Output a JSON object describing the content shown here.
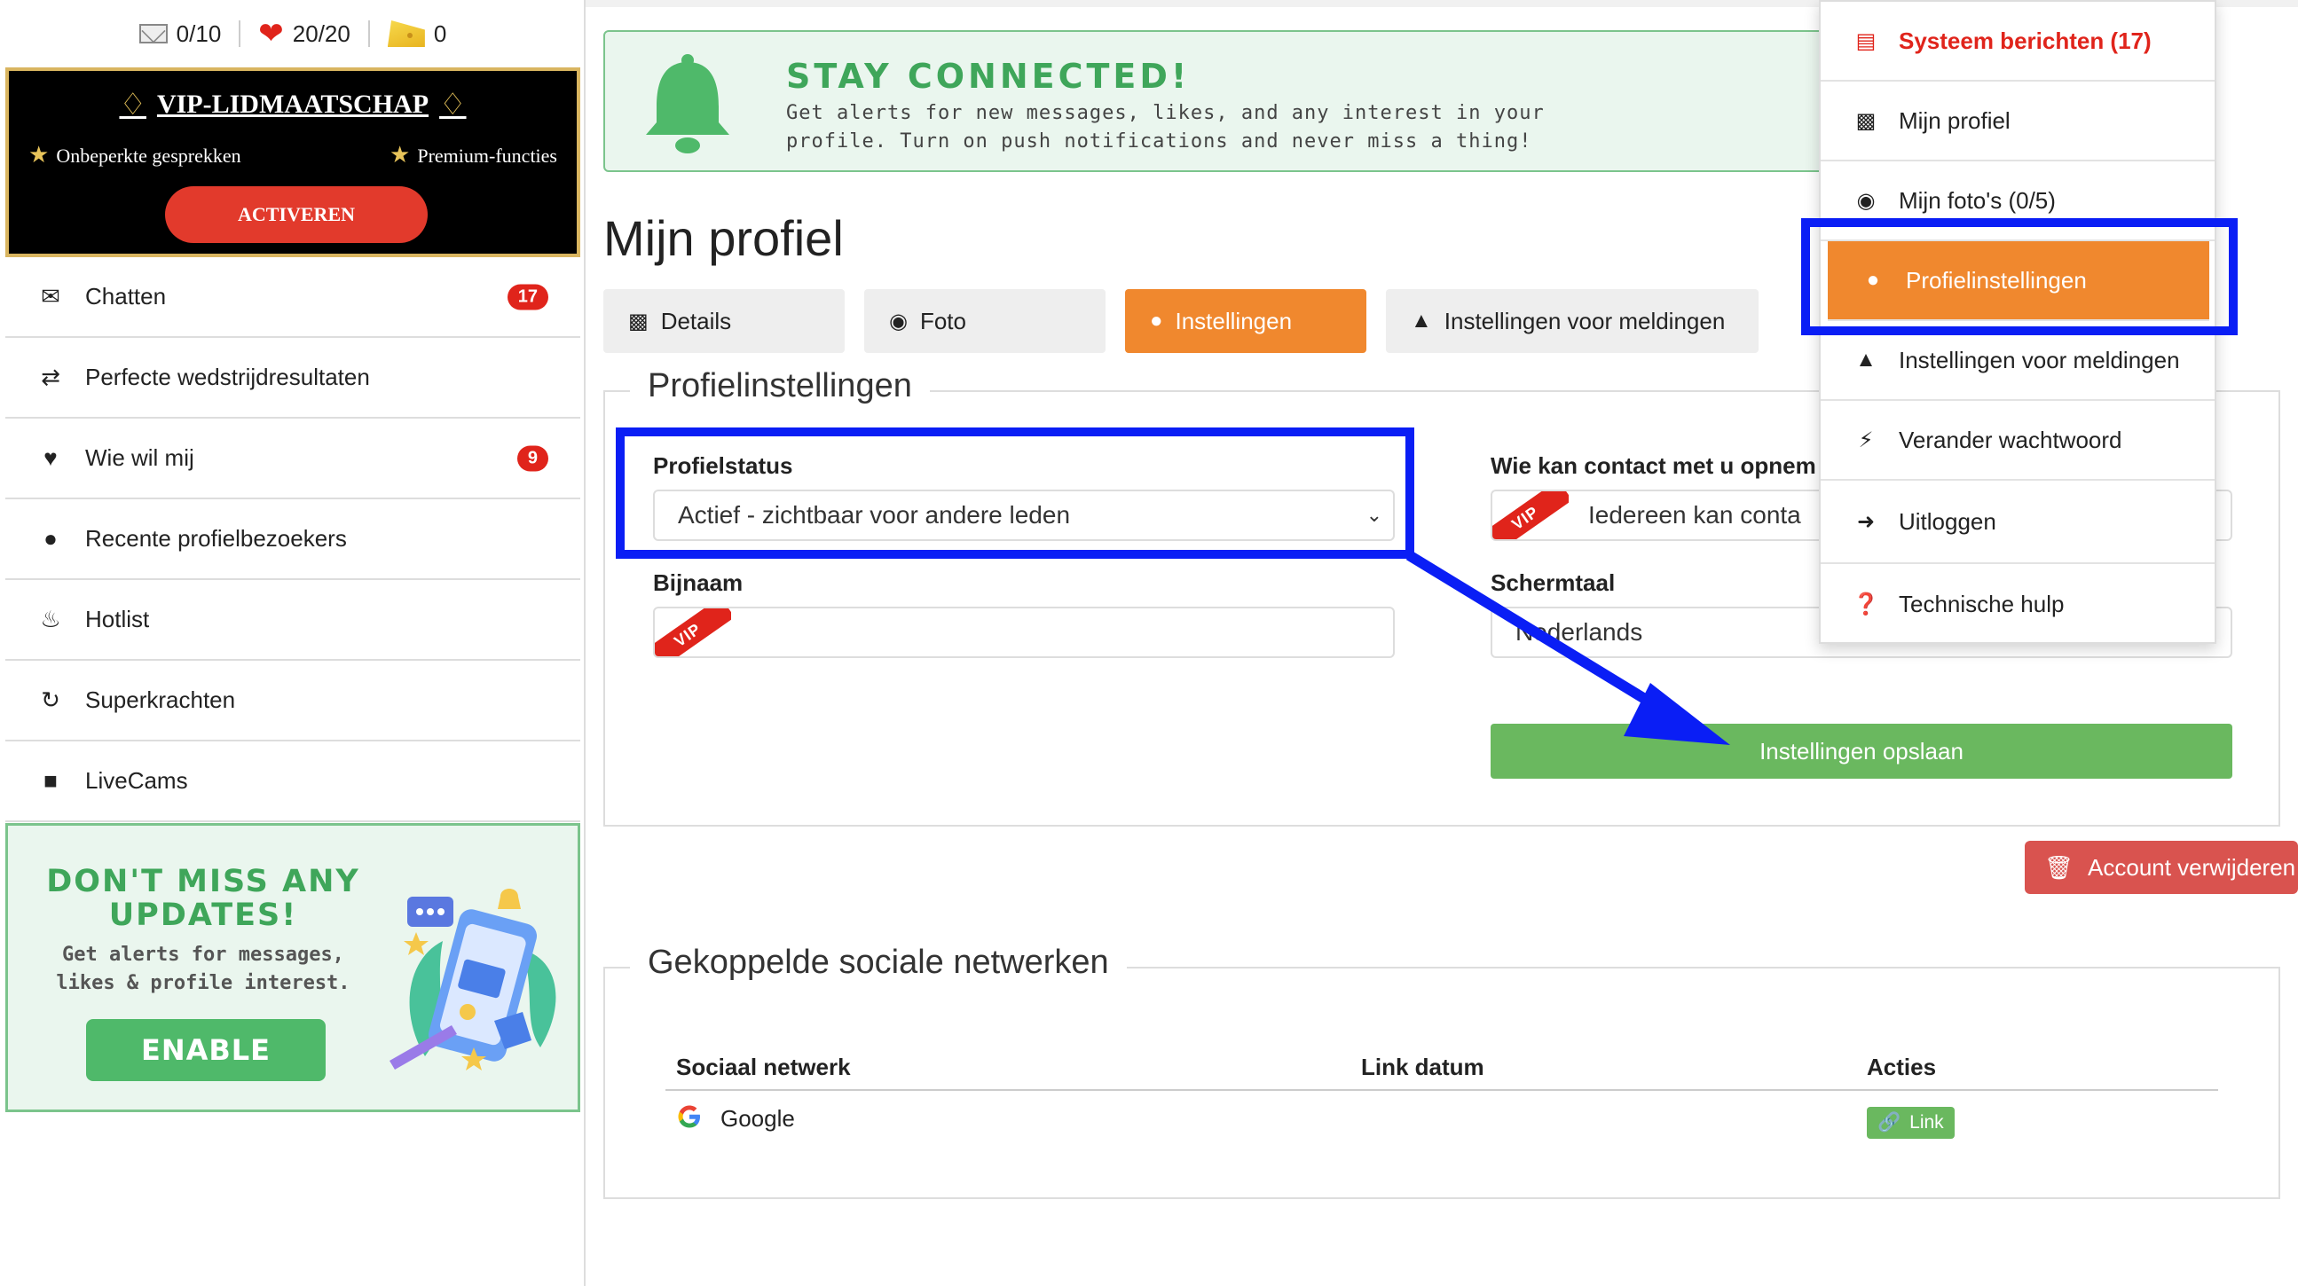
{
  "sidebar": {
    "stats": {
      "messages": "0/10",
      "hearts": "20/20",
      "coins": "0"
    },
    "vip": {
      "title": "VIP-LIDMAATSCHAP",
      "feature1": "Onbeperkte gesprekken",
      "feature2": "Premium-functies",
      "button": "ACTIVEREN"
    },
    "nav": [
      {
        "label": "Chatten",
        "icon": "envelope-icon",
        "badge": "17"
      },
      {
        "label": "Perfecte wedstrijdresultaten",
        "icon": "shuffle-icon",
        "badge": ""
      },
      {
        "label": "Wie wil mij",
        "icon": "heart-icon",
        "badge": "9"
      },
      {
        "label": "Recente profielbezoekers",
        "icon": "user-icon",
        "badge": ""
      },
      {
        "label": "Hotlist",
        "icon": "fire-icon",
        "badge": ""
      },
      {
        "label": "Superkrachten",
        "icon": "refresh-icon",
        "badge": ""
      },
      {
        "label": "LiveCams",
        "icon": "video-icon",
        "badge": ""
      }
    ],
    "promo": {
      "title": "DON'T MISS ANY UPDATES!",
      "subtitle": "Get alerts for messages, likes & profile interest.",
      "button": "ENABLE"
    }
  },
  "banner": {
    "title": "STAY CONNECTED!",
    "text": "Get alerts for new messages, likes, and any interest in your profile. Turn on push notifications and never miss a thing!"
  },
  "page": {
    "title": "Mijn profiel",
    "tabs": [
      {
        "label": "Details",
        "icon": "id-card-icon"
      },
      {
        "label": "Foto",
        "icon": "camera-icon"
      },
      {
        "label": "Instellingen",
        "icon": "user-icon"
      },
      {
        "label": "Instellingen voor meldingen",
        "icon": "bell-icon"
      }
    ]
  },
  "settings": {
    "legend": "Profielinstellingen",
    "status_label": "Profielstatus",
    "status_value": "Actief - zichtbaar voor andere leden",
    "nickname_label": "Bijnaam",
    "nickname_value": "",
    "contact_label": "Wie kan contact met u opnem",
    "contact_value": "Iedereen kan conta",
    "language_label": "Schermtaal",
    "language_value": "Nederlands",
    "vip_tag": "VIP",
    "save_button": "Instellingen opslaan"
  },
  "delete_button": "Account verwijderen",
  "social": {
    "legend": "Gekoppelde sociale netwerken",
    "columns": [
      "Sociaal netwerk",
      "Link datum",
      "Acties"
    ],
    "rows": [
      {
        "network": "Google",
        "date": "",
        "action": "Link"
      }
    ]
  },
  "dropdown": [
    {
      "label": "Systeem berichten (17)",
      "icon": "list-icon"
    },
    {
      "label": "Mijn profiel",
      "icon": "id-card-icon"
    },
    {
      "label": "Mijn foto's (0/5)",
      "icon": "camera-icon"
    },
    {
      "label": "Profielinstellingen",
      "icon": "user-icon"
    },
    {
      "label": "Instellingen voor meldingen",
      "icon": "bell-icon"
    },
    {
      "label": "Verander wachtwoord",
      "icon": "bolt-icon"
    },
    {
      "label": "Uitloggen",
      "icon": "logout-icon"
    },
    {
      "label": "Technische hulp",
      "icon": "help-icon"
    }
  ],
  "colors": {
    "accent_orange": "#f0882e",
    "success_green": "#6ab85f",
    "danger_red": "#d9534f",
    "annotation_blue": "#0a1ef5"
  }
}
